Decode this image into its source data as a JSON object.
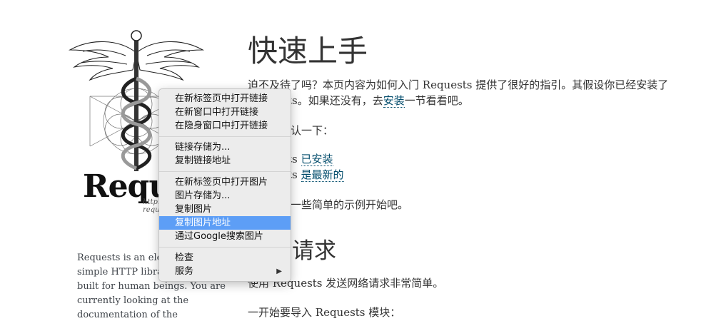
{
  "sidebar": {
    "logo_word": "Requests",
    "logo_url": "http://python-requests.org",
    "blurb_lines": [
      "Requests is an elegant and",
      "simple HTTP library for Python,",
      "built for human beings. You are",
      "currently looking at the",
      "documentation of the"
    ]
  },
  "main": {
    "title": "快速上手",
    "intro_line1": "迫不及待了吗？本页内容为如何入门 Requests 提供了很好的指引。其假设你已经安装了",
    "intro_line2_pre": "Requests。如果还没有，去",
    "intro_line2_link": "安装",
    "intro_line2_post": "一节看看吧。",
    "confirm": "首先，确认一下：",
    "check1_pre": "Requests ",
    "check1_link": "已安装",
    "check2_pre": "Requests ",
    "check2_link": "是最新的",
    "examples": "让我们从一些简单的示例开始吧。",
    "section_title": "发送请求",
    "send_text": "使用 Requests 发送网络请求非常简单。",
    "import_text": "一开始要导入 Requests 模块："
  },
  "context_menu": {
    "items": [
      {
        "label": "在新标签页中打开链接"
      },
      {
        "label": "在新窗口中打开链接"
      },
      {
        "label": "在隐身窗口中打开链接"
      },
      {
        "label": "链接存储为..."
      },
      {
        "label": "复制链接地址"
      },
      {
        "label": "在新标签页中打开图片"
      },
      {
        "label": "图片存储为..."
      },
      {
        "label": "复制图片"
      },
      {
        "label": "复制图片地址",
        "highlighted": true
      },
      {
        "label": "通过Google搜索图片"
      },
      {
        "label": "检查"
      },
      {
        "label": "服务",
        "submenu": true
      }
    ],
    "highlight_color": "#5d9ef6"
  }
}
